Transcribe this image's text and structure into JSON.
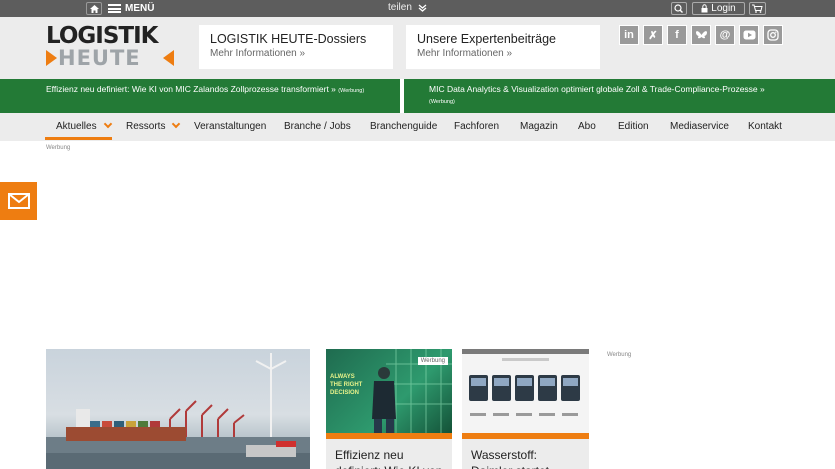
{
  "topbar": {
    "menu_label": "MENÜ",
    "share_label": "teilen",
    "login_label": "Login"
  },
  "icons": {
    "home": "home-icon",
    "menu": "hamburger-icon",
    "share": "chevron-down-double-icon",
    "search": "search-icon",
    "lock": "lock-icon",
    "cart": "cart-icon",
    "mail": "mail-icon"
  },
  "logo": {
    "line1": "LOGISTIK",
    "line2": "HEUTE"
  },
  "header": {
    "box1": {
      "title": "LOGISTIK HEUTE-Dossiers",
      "sub": "Mehr Informationen »"
    },
    "box2": {
      "title": "Unsere Expertenbeiträge",
      "sub": "Mehr Informationen »"
    }
  },
  "social": [
    "in",
    "X",
    "f",
    "bsky",
    "@",
    "yt",
    "ig"
  ],
  "promo": {
    "left": {
      "text": "Effizienz neu definiert: Wie KI von MIC Zalandos Zollprozesse transformiert »",
      "tag": "(Werbung)"
    },
    "right": {
      "text": "MIC Data Analytics & Visualization optimiert globale Zoll & Trade-Compliance-Prozesse »",
      "tag": "(Werbung)"
    }
  },
  "nav": [
    "Aktuelles",
    "Ressorts",
    "Veranstaltungen",
    "Branche / Jobs",
    "Branchenguide",
    "Fachforen",
    "Magazin",
    "Abo",
    "Edition",
    "Mediaservice",
    "Kontakt"
  ],
  "ads": {
    "top": "Werbung",
    "right": "Werbung"
  },
  "cards": {
    "c2": {
      "badge": "Werbung",
      "img_text": "ALWAYS THE RIGHT DECISION",
      "caption": "Effizienz neu definiert: Wie KI von"
    },
    "c3": {
      "caption": "Wasserstoff: Daimler startet zweite"
    }
  },
  "colors": {
    "accent": "#ee7d11",
    "green": "#237a36",
    "topbar": "#5d5d5d",
    "header_bg": "#ececec"
  }
}
